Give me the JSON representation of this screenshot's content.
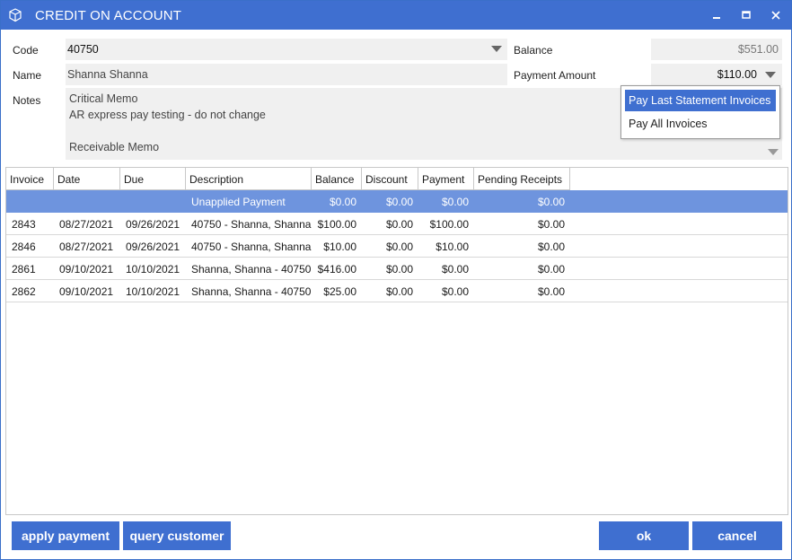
{
  "window": {
    "title": "CREDIT ON ACCOUNT",
    "accent_color": "#3f6fd0"
  },
  "form": {
    "code_label": "Code",
    "code_value": "40750",
    "name_label": "Name",
    "name_value": "Shanna Shanna",
    "notes_label": "Notes",
    "notes_lines": [
      "Critical Memo",
      "AR express pay testing - do not change",
      "",
      "Receivable Memo"
    ],
    "balance_label": "Balance",
    "balance_value": "$551.00",
    "payment_amount_label": "Payment Amount",
    "payment_amount_value": "$110.00"
  },
  "dropdown": {
    "options": [
      "Pay Last Statement Invoices",
      "Pay All Invoices"
    ],
    "selected_index": 0
  },
  "grid": {
    "columns": [
      "Invoice",
      "Date",
      "Due",
      "Description",
      "Balance",
      "Discount",
      "Payment",
      "Pending Receipts"
    ],
    "rows": [
      {
        "invoice": "",
        "date": "",
        "due": "",
        "description": "Unapplied Payment",
        "balance": "$0.00",
        "discount": "$0.00",
        "payment": "$0.00",
        "pending": "$0.00",
        "selected": true
      },
      {
        "invoice": "2843",
        "date": "08/27/2021",
        "due": "09/26/2021",
        "description": "40750 - Shanna, Shanna",
        "balance": "$100.00",
        "discount": "$0.00",
        "payment": "$100.00",
        "pending": "$0.00",
        "selected": false
      },
      {
        "invoice": "2846",
        "date": "08/27/2021",
        "due": "09/26/2021",
        "description": "40750 - Shanna, Shanna",
        "balance": "$10.00",
        "discount": "$0.00",
        "payment": "$10.00",
        "pending": "$0.00",
        "selected": false
      },
      {
        "invoice": "2861",
        "date": "09/10/2021",
        "due": "10/10/2021",
        "description": "Shanna, Shanna - 40750",
        "balance": "$416.00",
        "discount": "$0.00",
        "payment": "$0.00",
        "pending": "$0.00",
        "selected": false
      },
      {
        "invoice": "2862",
        "date": "09/10/2021",
        "due": "10/10/2021",
        "description": "Shanna, Shanna - 40750",
        "balance": "$25.00",
        "discount": "$0.00",
        "payment": "$0.00",
        "pending": "$0.00",
        "selected": false
      }
    ]
  },
  "buttons": {
    "apply_payment": "apply payment",
    "query_customer": "query customer",
    "ok": "ok",
    "cancel": "cancel"
  }
}
